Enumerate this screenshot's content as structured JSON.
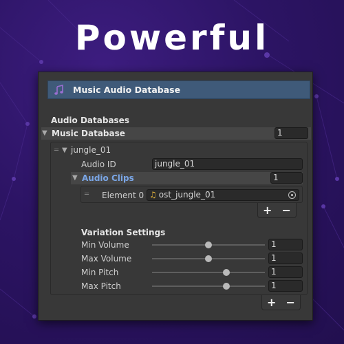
{
  "headline": "Powerful",
  "window": {
    "title": "Music Audio Database",
    "icon": "music-note-icon"
  },
  "databases": {
    "section_label": "Audio Databases",
    "music_database_label": "Music Database",
    "music_database_count": "1"
  },
  "entry": {
    "name": "jungle_01",
    "audio_id_label": "Audio ID",
    "audio_id_value": "jungle_01",
    "audio_clips_label": "Audio Clips",
    "audio_clips_count": "1",
    "element_label": "Element 0",
    "element_value": "ost_jungle_01",
    "add_label": "+",
    "remove_label": "−"
  },
  "variation": {
    "section_label": "Variation Settings",
    "min_volume_label": "Min Volume",
    "min_volume_value": "1",
    "max_volume_label": "Max Volume",
    "max_volume_value": "1",
    "min_pitch_label": "Min Pitch",
    "min_pitch_value": "1",
    "max_pitch_label": "Max Pitch",
    "max_pitch_value": "1"
  },
  "footer": {
    "add_label": "+",
    "remove_label": "−"
  },
  "colors": {
    "background": "#2c1464",
    "header": "#3f5a79",
    "panel": "#383838",
    "accent_label": "#7aa6e6",
    "audio_icon": "#e5b43a"
  }
}
